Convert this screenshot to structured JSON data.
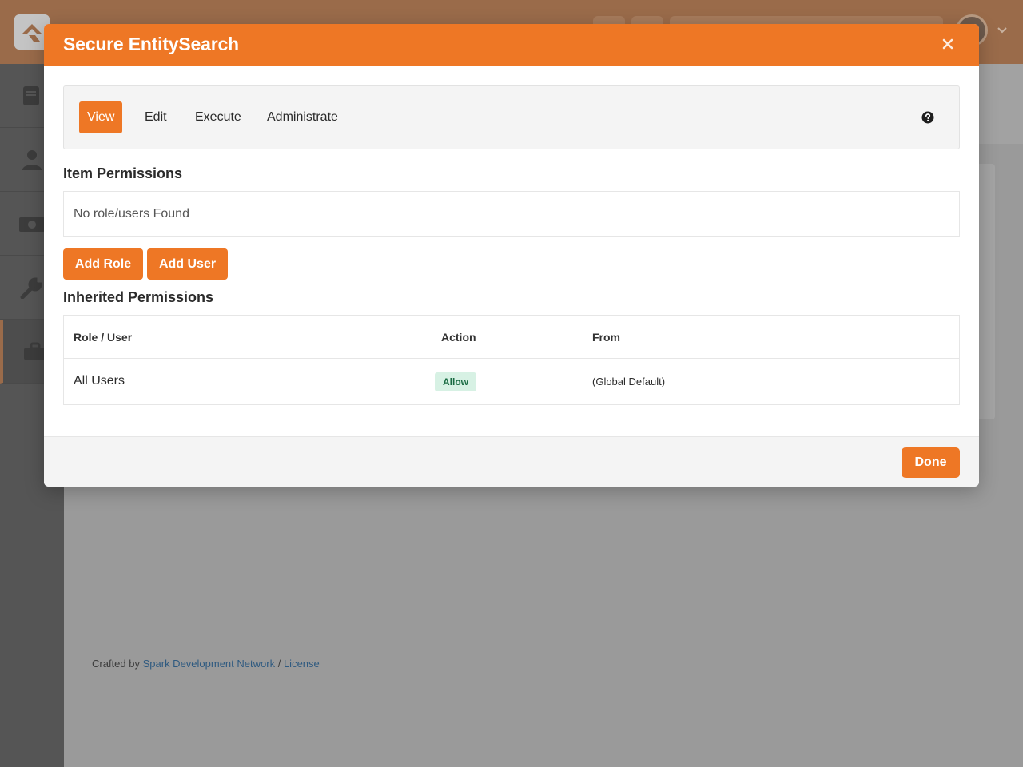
{
  "modal": {
    "title": "Secure EntitySearch",
    "close_icon": "close-icon",
    "tabs": [
      {
        "label": "View",
        "active": true
      },
      {
        "label": "Edit",
        "active": false
      },
      {
        "label": "Execute",
        "active": false
      },
      {
        "label": "Administrate",
        "active": false
      }
    ],
    "help_icon": "question-circle-icon",
    "item_permissions": {
      "heading": "Item Permissions",
      "empty_text": "No role/users Found"
    },
    "buttons": {
      "add_role": "Add Role",
      "add_user": "Add User"
    },
    "inherited_permissions": {
      "heading": "Inherited Permissions",
      "columns": [
        "Role / User",
        "Action",
        "From"
      ],
      "rows": [
        {
          "role": "All Users",
          "action": "Allow",
          "from": "(Global Default)"
        }
      ]
    },
    "done_label": "Done"
  },
  "footer": {
    "prefix": "Crafted by",
    "link1": "Spark Development Network",
    "separator": "/",
    "link2": "License"
  },
  "colors": {
    "accent": "#ee7725",
    "allow_badge_bg": "#d7f1e4",
    "allow_badge_text": "#1a6b43"
  },
  "sidebar_icons": [
    "book-icon",
    "person-icon",
    "money-icon",
    "wrench-icon",
    "briefcase-icon"
  ]
}
